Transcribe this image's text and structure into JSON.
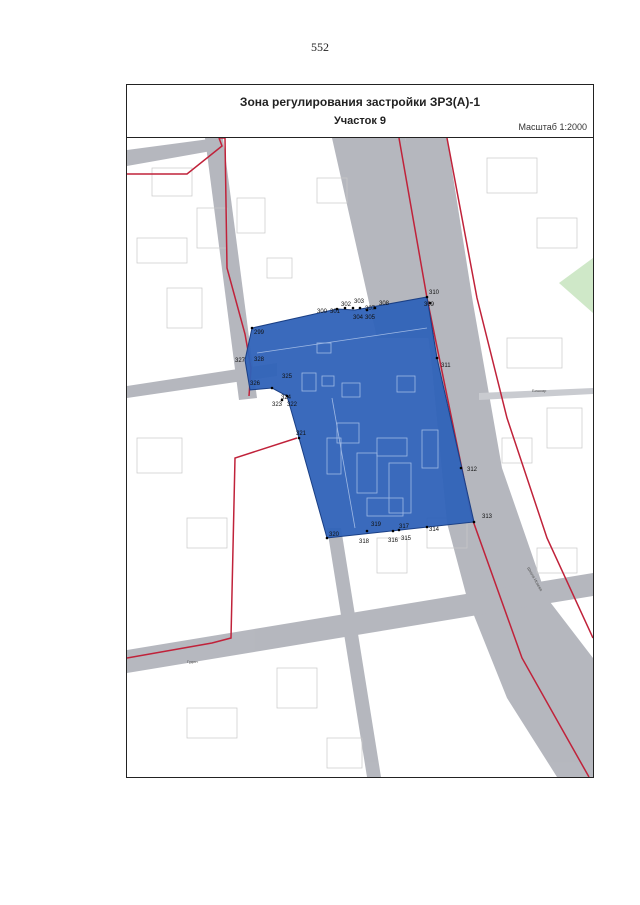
{
  "page": {
    "number": "552"
  },
  "title": {
    "line1": "Зона регулирования застройки ЗРЗ(А)-1",
    "line2": "Участок 9",
    "scale": "Масштаб 1:2000"
  },
  "colors": {
    "zone_border": "#c0223a",
    "parcel_fill": "#2f62b8",
    "parcel_stroke": "#1a3f85",
    "road": "#aeb0b8",
    "building_outline": "#c8c8c8",
    "green_area": "#cfe8c8"
  },
  "map": {
    "street_labels": [
      "Бишкар",
      "Гудин",
      "Школа Исаева"
    ],
    "point_labels": [
      {
        "id": "p299",
        "text": "299"
      },
      {
        "id": "p300",
        "text": "300"
      },
      {
        "id": "p301",
        "text": "301"
      },
      {
        "id": "p302",
        "text": "302"
      },
      {
        "id": "p303",
        "text": "303"
      },
      {
        "id": "p304",
        "text": "304"
      },
      {
        "id": "p305",
        "text": "305"
      },
      {
        "id": "p307",
        "text": "307"
      },
      {
        "id": "p308",
        "text": "308"
      },
      {
        "id": "p309",
        "text": "309"
      },
      {
        "id": "p310",
        "text": "310"
      },
      {
        "id": "p311",
        "text": "311"
      },
      {
        "id": "p312",
        "text": "312"
      },
      {
        "id": "p313",
        "text": "313"
      },
      {
        "id": "p314",
        "text": "314"
      },
      {
        "id": "p315",
        "text": "315"
      },
      {
        "id": "p316",
        "text": "316"
      },
      {
        "id": "p317",
        "text": "317"
      },
      {
        "id": "p318",
        "text": "318"
      },
      {
        "id": "p319",
        "text": "319"
      },
      {
        "id": "p320",
        "text": "320"
      },
      {
        "id": "p321",
        "text": "321"
      },
      {
        "id": "p322",
        "text": "322"
      },
      {
        "id": "p323",
        "text": "323"
      },
      {
        "id": "p324",
        "text": "324"
      },
      {
        "id": "p325",
        "text": "325"
      },
      {
        "id": "p326",
        "text": "326"
      },
      {
        "id": "p327",
        "text": "327"
      },
      {
        "id": "p328",
        "text": "328"
      }
    ]
  }
}
